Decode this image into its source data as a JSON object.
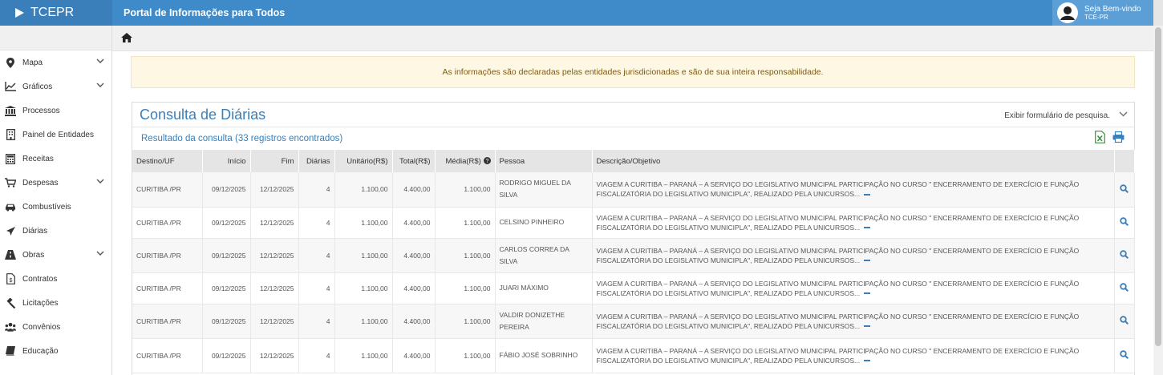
{
  "header": {
    "brand": "TCEPR",
    "portal_title": "Portal de Informações para Todos",
    "user_greeting": "Seja Bem-vindo",
    "user_org": "TCE-PR"
  },
  "sidebar": {
    "items": [
      {
        "label": "Mapa",
        "icon": "map-marker-icon",
        "expandable": true
      },
      {
        "label": "Gráficos",
        "icon": "line-chart-icon",
        "expandable": true
      },
      {
        "label": "Processos",
        "icon": "institution-icon",
        "expandable": false
      },
      {
        "label": "Painel de Entidades",
        "icon": "building-icon",
        "expandable": false
      },
      {
        "label": "Receitas",
        "icon": "calculator-icon",
        "expandable": false
      },
      {
        "label": "Despesas",
        "icon": "cart-icon",
        "expandable": true
      },
      {
        "label": "Combustíveis",
        "icon": "car-icon",
        "expandable": false
      },
      {
        "label": "Diárias",
        "icon": "plane-icon",
        "expandable": false
      },
      {
        "label": "Obras",
        "icon": "road-icon",
        "expandable": true
      },
      {
        "label": "Contratos",
        "icon": "contract-file-icon",
        "expandable": false
      },
      {
        "label": "Licitações",
        "icon": "gavel-icon",
        "expandable": false
      },
      {
        "label": "Convênios",
        "icon": "group-icon",
        "expandable": false
      },
      {
        "label": "Educação",
        "icon": "book-icon",
        "expandable": false
      }
    ]
  },
  "notice": "As informações são declaradas pelas entidades jurisdicionadas e são de sua inteira responsabilidade.",
  "panel": {
    "title": "Consulta de Diárias",
    "toggle_label": "Exibir formulário de pesquisa.",
    "result_summary": "Resultado da consulta (33 registros encontrados)"
  },
  "table": {
    "columns": [
      "Destino/UF",
      "Início",
      "Fim",
      "Diárias",
      "Unitário(R$)",
      "Total(R$)",
      "Média(R$)",
      "Pessoa",
      "Descrição/Objetivo"
    ],
    "rows": [
      {
        "destino": "CURITIBA /PR",
        "inicio": "09/12/2025",
        "fim": "12/12/2025",
        "diarias": "4",
        "unitario": "1.100,00",
        "total": "4.400,00",
        "media": "1.100,00",
        "pessoa": "RODRIGO MIGUEL DA SILVA",
        "descricao": "VIAGEM A CURITIBA – PARANÁ – A SERVIÇO DO LEGISLATIVO MUNICIPAL PARTICIPAÇÃO NO CURSO \" ENCERRAMENTO DE EXERCÍCIO E FUNÇÃO FISCALIZATÓRIA DO LEGISLATIVO MUNICIPLA\", REALIZADO PELA UNICURSOS..."
      },
      {
        "destino": "CURITIBA /PR",
        "inicio": "09/12/2025",
        "fim": "12/12/2025",
        "diarias": "4",
        "unitario": "1.100,00",
        "total": "4.400,00",
        "media": "1.100,00",
        "pessoa": "CELSINO PINHEIRO",
        "descricao": "VIAGEM A CURITIBA – PARANÁ – A SERVIÇO DO LEGISLATIVO MUNICIPAL PARTICIPAÇÃO NO CURSO \" ENCERRAMENTO DE EXERCÍCIO E FUNÇÃO FISCALIZATÓRIA DO LEGISLATIVO MUNICIPLA\", REALIZADO PELA UNICURSOS..."
      },
      {
        "destino": "CURITIBA /PR",
        "inicio": "09/12/2025",
        "fim": "12/12/2025",
        "diarias": "4",
        "unitario": "1.100,00",
        "total": "4.400,00",
        "media": "1.100,00",
        "pessoa": "CARLOS CORREA DA SILVA",
        "descricao": "VIAGEM A CURITIBA – PARANÁ – A SERVIÇO DO LEGISLATIVO MUNICIPAL PARTICIPAÇÃO NO CURSO \" ENCERRAMENTO DE EXERCÍCIO E FUNÇÃO FISCALIZATÓRIA DO LEGISLATIVO MUNICIPLA\", REALIZADO PELA UNICURSOS..."
      },
      {
        "destino": "CURITIBA /PR",
        "inicio": "09/12/2025",
        "fim": "12/12/2025",
        "diarias": "4",
        "unitario": "1.100,00",
        "total": "4.400,00",
        "media": "1.100,00",
        "pessoa": "JUARI MÁXIMO",
        "descricao": "VIAGEM A CURITIBA – PARANÁ – A SERVIÇO DO LEGISLATIVO MUNICIPAL PARTICIPAÇÃO NO CURSO \" ENCERRAMENTO DE EXERCÍCIO E FUNÇÃO FISCALIZATÓRIA DO LEGISLATIVO MUNICIPLA\", REALIZADO PELA UNICURSOS..."
      },
      {
        "destino": "CURITIBA /PR",
        "inicio": "09/12/2025",
        "fim": "12/12/2025",
        "diarias": "4",
        "unitario": "1.100,00",
        "total": "4.400,00",
        "media": "1.100,00",
        "pessoa": "VALDIR DONIZETHE PEREIRA",
        "descricao": "VIAGEM A CURITIBA – PARANÁ – A SERVIÇO DO LEGISLATIVO MUNICIPAL PARTICIPAÇÃO NO CURSO \" ENCERRAMENTO DE EXERCÍCIO E FUNÇÃO FISCALIZATÓRIA DO LEGISLATIVO MUNICIPLA\", REALIZADO PELA UNICURSOS..."
      },
      {
        "destino": "CURITIBA /PR",
        "inicio": "09/12/2025",
        "fim": "12/12/2025",
        "diarias": "4",
        "unitario": "1.100,00",
        "total": "4.400,00",
        "media": "1.100,00",
        "pessoa": "FÁBIO JOSÉ SOBRINHO",
        "descricao": "VIAGEM A CURITIBA – PARANÁ – A SERVIÇO DO LEGISLATIVO MUNICIPAL PARTICIPAÇÃO NO CURSO \" ENCERRAMENTO DE EXERCÍCIO E FUNÇÃO FISCALIZATÓRIA DO LEGISLATIVO MUNICIPLA\", REALIZADO PELA UNICURSOS..."
      }
    ]
  },
  "colors": {
    "header_blue": "#3f8bc9",
    "logo_blue": "#3a7fb9",
    "accent_blue": "#3a7fb9",
    "notice_bg": "#fdf7e3",
    "notice_text": "#7b5b14",
    "excel_green": "#3c8f3c"
  }
}
